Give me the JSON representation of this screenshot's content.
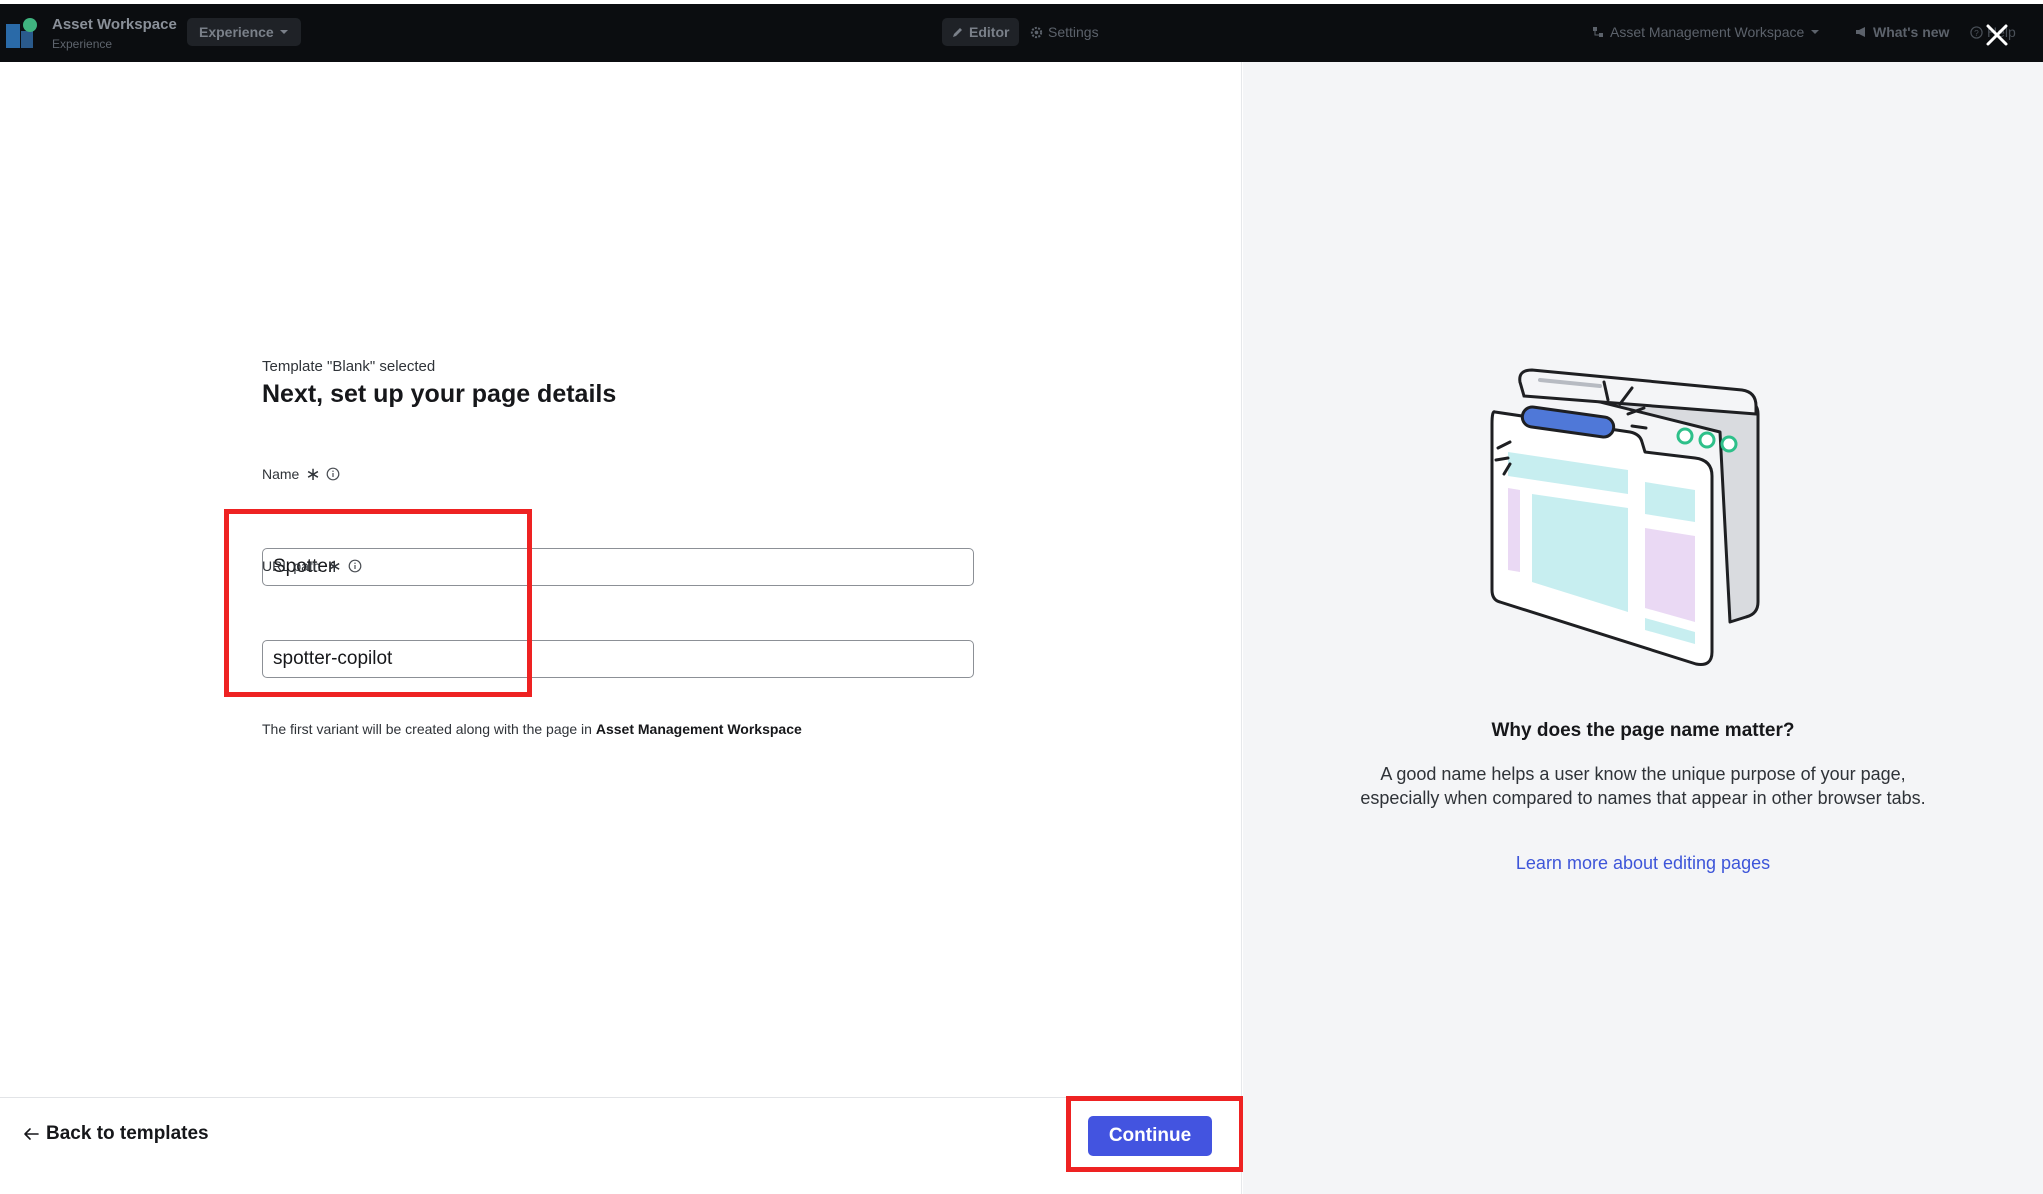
{
  "topbar": {
    "app_title": "Asset Workspace",
    "app_subtitle": "Experience",
    "experience_label": "Experience",
    "editor_label": "Editor",
    "settings_label": "Settings",
    "workspace_label": "Asset Management Workspace",
    "whats_new_label": "What's new",
    "help_label": "Help"
  },
  "form": {
    "template_note": "Template \"Blank\" selected",
    "title": "Next, set up your page details",
    "name_label": "Name",
    "name_value": "Spotter",
    "url_label": "URL path",
    "url_value": "spotter-copilot",
    "required_mark": "∗",
    "variant_note_prefix": "The first variant will be created along with the page in ",
    "variant_note_target": "Asset Management Workspace"
  },
  "footer": {
    "back_label": "Back to templates",
    "continue_label": "Continue"
  },
  "info": {
    "title": "Why does the page name matter?",
    "body": "A good name helps a user know the unique purpose of your page, especially when compared to names that appear in other browser tabs.",
    "link_label": "Learn more about editing pages"
  },
  "colors": {
    "topbar_bg": "#0b0d10",
    "primary_button": "#4354e0",
    "link": "#3d55d9",
    "highlight": "#ee2222",
    "right_panel_bg": "#f4f5f7"
  },
  "icons": [
    "logo",
    "chevron-down-icon",
    "pencil-icon",
    "gear-icon",
    "workspace-icon",
    "megaphone-icon",
    "help-icon",
    "close-icon",
    "info-icon",
    "arrow-left-icon",
    "browser-illustration"
  ]
}
